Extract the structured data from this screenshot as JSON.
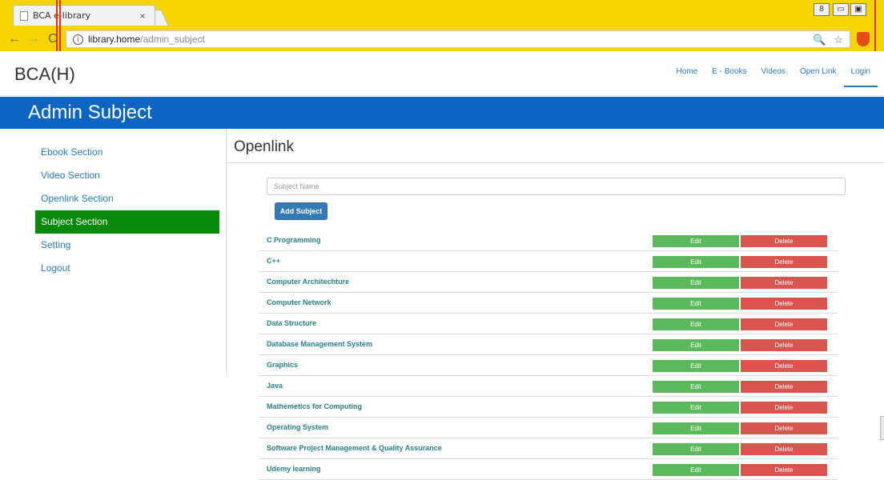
{
  "browser": {
    "tab_title": "BCA e-library",
    "tab_close": "×",
    "url_host": "library.home",
    "url_path": "/admin_subject",
    "back": "←",
    "forward": "→",
    "reload": "C",
    "info": "i",
    "zoom": "🔍",
    "star": "☆",
    "min": "▭",
    "max": "▣",
    "user": "8"
  },
  "site": {
    "brand": "BCA(H)",
    "nav": [
      "Home",
      "E - Books",
      "Videos",
      "Open Link",
      "Login"
    ]
  },
  "header": {
    "title": "Admin Subject"
  },
  "sidebar": {
    "items": [
      {
        "label": "Ebook Section"
      },
      {
        "label": "Video Section"
      },
      {
        "label": "Openlink Section"
      },
      {
        "label": "Subject Section"
      },
      {
        "label": "Setting"
      },
      {
        "label": "Logout"
      }
    ],
    "active_index": 3
  },
  "main": {
    "title": "Openlink",
    "input_placeholder": "Subject Name",
    "add_button": "Add Subject",
    "edit_label": "Edit",
    "delete_label": "Delete",
    "subjects": [
      "C Programming",
      "C++",
      "Computer Architechture",
      "Computer Network",
      "Data Structure",
      "Database Management System",
      "Graphics",
      "Java",
      "Mathemetics for Computing",
      "Operating System",
      "Software Project Management & Quality Assurance",
      "Udemy learning"
    ]
  },
  "colors": {
    "chrome": "#f6d400",
    "header": "#0b66c3",
    "active_sidebar": "#0a8a0a",
    "edit": "#5cb85c",
    "delete": "#d9534f",
    "primary": "#337ab7"
  }
}
